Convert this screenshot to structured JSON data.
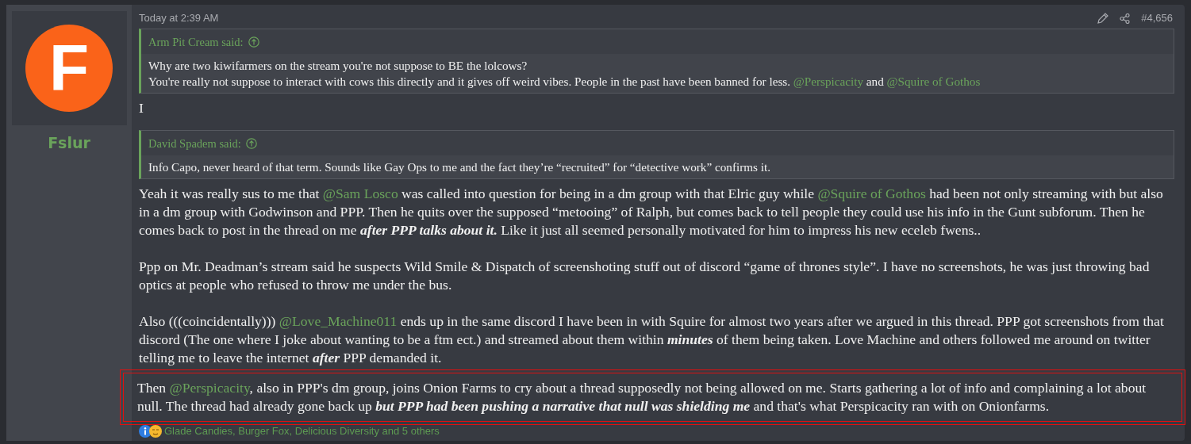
{
  "post": {
    "author": "Fslur",
    "avatar_letter": "F",
    "timestamp": "Today at 2:39 AM",
    "post_number": "#4,656",
    "blocks": [
      {
        "kind": "quote",
        "author": "Arm Pit Cream said:",
        "lines": [
          [
            {
              "kind": "plain",
              "text": "Why are two kiwifarmers on the stream you're not suppose to BE the lolcows?"
            }
          ],
          [
            {
              "kind": "plain",
              "text": "You're really not suppose to interact with cows this directly and it gives off weird vibes. People in the past have been banned for less. "
            },
            {
              "kind": "mention",
              "text": "@Perspicacity"
            },
            {
              "kind": "plain",
              "text": " and "
            },
            {
              "kind": "mention",
              "text": "@Squire of Gothos"
            }
          ]
        ]
      },
      {
        "kind": "paragraph",
        "highlighted": false,
        "segments": [
          {
            "kind": "plain",
            "text": "I"
          }
        ]
      },
      {
        "kind": "quote",
        "author": "David Spadem said:",
        "lines": [
          [
            {
              "kind": "plain",
              "text": "Info Capo, never heard of that term. Sounds like Gay Ops to me and the fact they’re “recruited” for “detective work” confirms it."
            }
          ]
        ]
      },
      {
        "kind": "paragraph",
        "highlighted": false,
        "segments": [
          {
            "kind": "plain",
            "text": "Yeah it was really sus to me that "
          },
          {
            "kind": "mention",
            "text": "@Sam Losco"
          },
          {
            "kind": "plain",
            "text": " was called into question for being in a dm group with that Elric guy while "
          },
          {
            "kind": "mention",
            "text": "@Squire of Gothos"
          },
          {
            "kind": "plain",
            "text": " had been not only streaming with but also in a dm group with Godwinson and PPP. Then he quits over the supposed “metooing” of Ralph, but comes back to tell people they could use his info in the Gunt subforum. Then he comes back to post in the thread on me "
          },
          {
            "kind": "bold_italic",
            "text": "after PPP talks about it."
          },
          {
            "kind": "plain",
            "text": " Like it just all seemed personally motivated for him to impress his new eceleb fwens.."
          }
        ]
      },
      {
        "kind": "paragraph",
        "highlighted": false,
        "segments": [
          {
            "kind": "plain",
            "text": "Ppp on Mr. Deadman’s stream said he suspects Wild Smile & Dispatch of screenshoting stuff out of discord “game of thrones style”. I have no screenshots, he was just throwing bad optics at people who refused to throw me under the bus."
          }
        ]
      },
      {
        "kind": "paragraph",
        "highlighted": false,
        "segments": [
          {
            "kind": "plain",
            "text": "Also (((coincidentally))) "
          },
          {
            "kind": "mention",
            "text": "@Love_Machine011"
          },
          {
            "kind": "plain",
            "text": " ends up in the same discord I have been in with Squire for almost two years after we argued in this thread. PPP got screenshots from that discord (The one where I joke about wanting to be a ftm ect.) and streamed about them within "
          },
          {
            "kind": "bold_italic",
            "text": "minutes"
          },
          {
            "kind": "plain",
            "text": " of them being taken. Love Machine and others followed me around on twitter telling me to leave the internet "
          },
          {
            "kind": "bold_italic",
            "text": "after"
          },
          {
            "kind": "plain",
            "text": " PPP demanded it."
          }
        ]
      },
      {
        "kind": "paragraph",
        "highlighted": true,
        "segments": [
          {
            "kind": "plain",
            "text": "Then "
          },
          {
            "kind": "mention",
            "text": "@Perspicacity"
          },
          {
            "kind": "plain",
            "text": ", also in PPP's dm group, joins Onion Farms to cry about a thread supposedly not being allowed on me. Starts gathering a lot of info and complaining a lot about null. The thread had already gone back up "
          },
          {
            "kind": "bold_italic",
            "text": "but PPP had been pushing a narrative that null was shielding me"
          },
          {
            "kind": "plain",
            "text": " and that's what Perspicacity ran with on Onionfarms."
          }
        ]
      }
    ],
    "reactions": {
      "text": "Glade Candies, Burger Fox, Delicious Diversity and 5 others"
    }
  }
}
